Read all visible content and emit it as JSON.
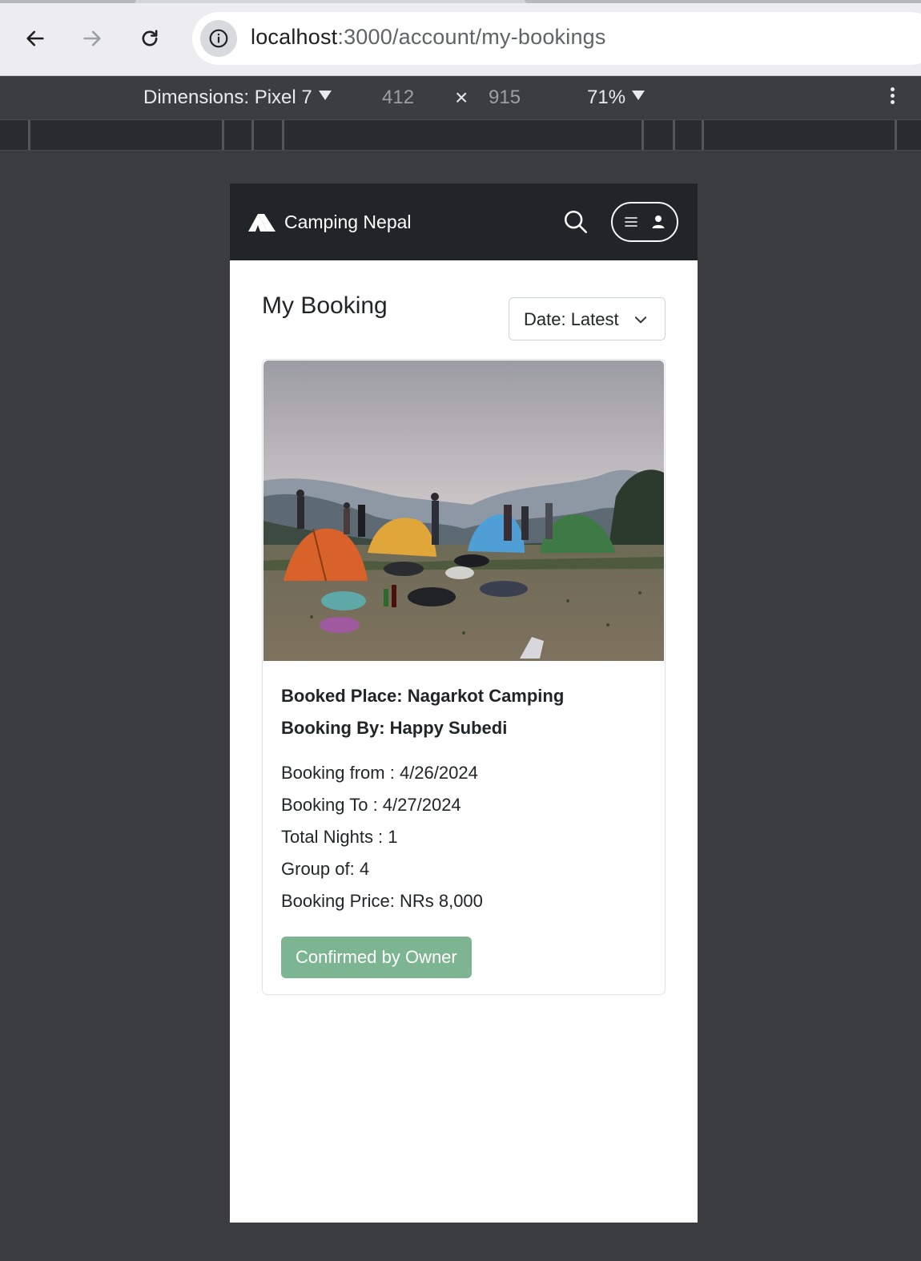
{
  "browser": {
    "url_host": "localhost",
    "url_path": ":3000/account/my-bookings",
    "devtools": {
      "device_label": "Dimensions: Pixel 7",
      "width": "412",
      "times": "×",
      "height": "915",
      "zoom": "71%"
    }
  },
  "app": {
    "brand": "Camping Nepal",
    "page_title": "My Booking",
    "sort": {
      "selected": "Date: Latest"
    },
    "booking": {
      "place": "Booked Place: Nagarkot Camping",
      "by": "Booking By: Happy Subedi",
      "from": "Booking from : 4/26/2024",
      "to": "Booking To : 4/27/2024",
      "nights": "Total Nights : 1",
      "group": "Group of: 4",
      "price": "Booking Price: NRs 8,000",
      "status": "Confirmed by Owner",
      "status_color": "#7db592"
    }
  }
}
